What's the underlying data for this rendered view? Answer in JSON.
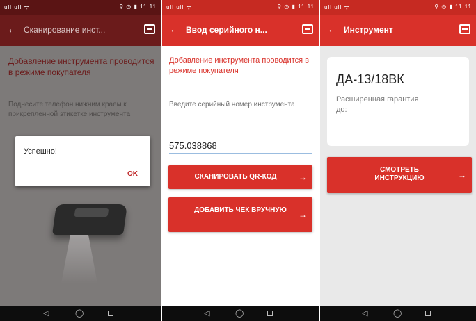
{
  "screens": [
    {
      "status_left": "ull ull ᯤ",
      "status_right": "⚲ ◷ ▮ 11:11",
      "back_icon": "arrow-left-icon",
      "title": "Сканирование инст...",
      "action_icon": "briefcase-icon",
      "heading": "Добавление инструмента проводится в режиме покупателя",
      "body": "Поднесите телефон нижним краем к прикрепленной этикетке инструмента",
      "dialog": {
        "message": "Успешно!",
        "ok_label": "OK"
      },
      "nav": {
        "back": "◁",
        "home": "◯",
        "recent": "□"
      }
    },
    {
      "status_left": "ull ull ᯤ",
      "status_right": "⚲ ◷ ▮ 11:11",
      "back_icon": "arrow-left-icon",
      "title": "Ввод серийного н...",
      "action_icon": "briefcase-icon",
      "heading": "Добавление инструмента проводится в режиме покупателя",
      "hint": "Введите серийный номер инструмента",
      "serial_value": "575.038868",
      "scan_button": "СКАНИРОВАТЬ QR-КОД",
      "add_button": "ДОБАВИТЬ ЧЕК ВРУЧНУЮ",
      "nav": {
        "back": "◁",
        "home": "◯",
        "recent": "□"
      }
    },
    {
      "status_left": "ull ull ᯤ",
      "status_right": "⚲ ◷ ▮ 11:11",
      "back_icon": "arrow-left-icon",
      "title": "Инструмент",
      "action_icon": "briefcase-icon",
      "tool_name": "ДА-13/18ВК",
      "warranty_label": "Расширенная гарантия до:",
      "instructions_button": "СМОТРЕТЬ ИНСТРУКЦИЮ",
      "nav": {
        "back": "◁",
        "home": "◯",
        "recent": "□"
      }
    }
  ],
  "colors": {
    "brand_red": "#d9312a",
    "dim_red": "#6b1b1b",
    "input_underline": "#9bbde0"
  }
}
